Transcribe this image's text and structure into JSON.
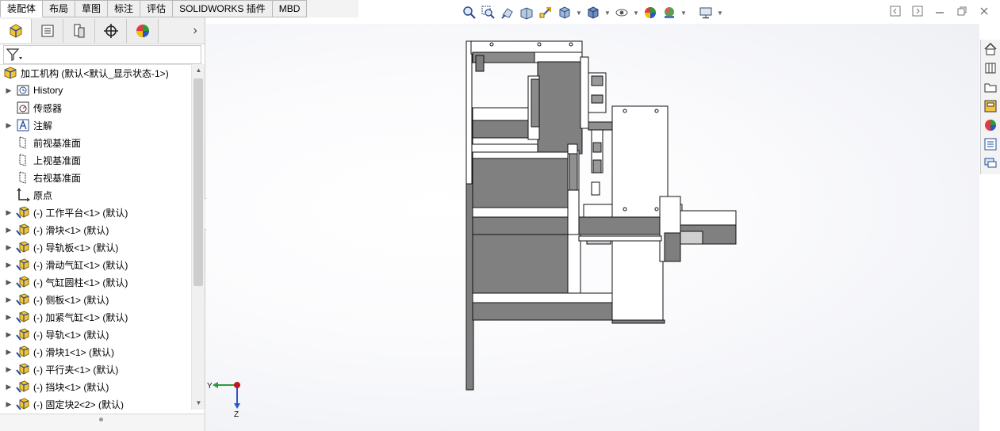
{
  "command_tabs": [
    "装配体",
    "布局",
    "草图",
    "标注",
    "评估",
    "SOLIDWORKS 插件",
    "MBD"
  ],
  "active_tab_index": 0,
  "hud_icons": [
    "zoom-to-fit-icon",
    "zoom-area-icon",
    "previous-view-icon",
    "section-view-icon",
    "dynamic-annotation-icon",
    "view-orientation-icon",
    "display-style-icon",
    "hide-show-icon",
    "edit-appearance-icon",
    "apply-scene-icon",
    "view-settings-icon"
  ],
  "panel_tabs": [
    "featuremanager-icon",
    "propertymanager-icon",
    "configurationmanager-icon",
    "dimxpert-icon",
    "displaymanager-icon"
  ],
  "tree": {
    "root": "加工机构 (默认<默认_显示状态-1>)",
    "items": [
      {
        "label": "History",
        "icon": "history-icon",
        "expandable": true
      },
      {
        "label": "传感器",
        "icon": "sensor-icon",
        "expandable": false
      },
      {
        "label": "注解",
        "icon": "annotation-icon",
        "expandable": true
      },
      {
        "label": "前视基准面",
        "icon": "plane-icon",
        "expandable": false
      },
      {
        "label": "上视基准面",
        "icon": "plane-icon",
        "expandable": false
      },
      {
        "label": "右视基准面",
        "icon": "plane-icon",
        "expandable": false
      },
      {
        "label": "原点",
        "icon": "origin-icon",
        "expandable": false
      },
      {
        "label": "(-) 工作平台<1> (默认)",
        "icon": "part-icon",
        "expandable": true
      },
      {
        "label": "(-) 滑块<1> (默认)",
        "icon": "part-icon",
        "expandable": true
      },
      {
        "label": "(-) 导轨板<1> (默认)",
        "icon": "part-icon",
        "expandable": true
      },
      {
        "label": "(-) 滑动气缸<1> (默认)",
        "icon": "part-icon",
        "expandable": true
      },
      {
        "label": "(-) 气缸圆柱<1> (默认)",
        "icon": "part-icon",
        "expandable": true
      },
      {
        "label": "(-) 侧板<1> (默认)",
        "icon": "part-icon",
        "expandable": true
      },
      {
        "label": "(-) 加紧气缸<1> (默认)",
        "icon": "part-icon",
        "expandable": true
      },
      {
        "label": "(-) 导轨<1> (默认)",
        "icon": "part-icon",
        "expandable": true
      },
      {
        "label": "(-) 滑块1<1> (默认)",
        "icon": "part-icon",
        "expandable": true
      },
      {
        "label": "(-) 平行夹<1> (默认)",
        "icon": "part-icon",
        "expandable": true
      },
      {
        "label": "(-) 挡块<1> (默认)",
        "icon": "part-icon",
        "expandable": true
      },
      {
        "label": "(-) 固定块2<2> (默认)",
        "icon": "part-icon",
        "expandable": true
      }
    ]
  },
  "triad": {
    "y_label": "Y",
    "z_label": "Z"
  },
  "taskpane_icons": [
    "home-icon",
    "design-library-icon",
    "file-explorer-icon",
    "view-palette-icon",
    "appearances-icon",
    "custom-properties-icon",
    "forum-icon"
  ],
  "colors": {
    "accent": "#4a90d9",
    "body_grey": "#7d7d7d",
    "triad_y": "#2e9a3a",
    "triad_z": "#2a55c9",
    "triad_origin": "#c0151b"
  }
}
